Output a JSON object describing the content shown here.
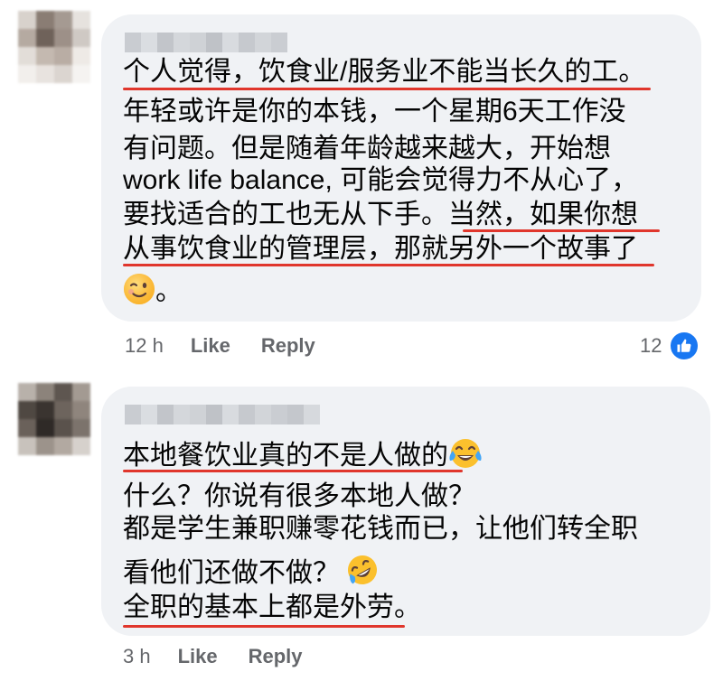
{
  "comments": [
    {
      "lines": [
        "个人觉得，饮食业/服务业不能当长久的工。",
        "年轻或许是你的本钱，一个星期6天工作没",
        "有问题。但是随着年龄越来越大，开始想",
        "work life balance, 可能会觉得力不从心了，",
        "要找适合的工也无从下手。当然，如果你想",
        "从事饮食业的管理层，那就另外一个故事了",
        "。"
      ],
      "emoji": "winking-face",
      "time": "12 h",
      "like_label": "Like",
      "reply_label": "Reply",
      "reaction_count": "12",
      "reaction_type": "like-icon"
    },
    {
      "lines": [
        "本地餐饮业真的不是人做的",
        "什么？你说有很多本地人做？",
        "都是学生兼职赚零花钱而已，让他们转全职",
        "看他们还做不做？",
        "全职的基本上都是外劳。"
      ],
      "emojis": [
        "face-with-tears-of-joy",
        "rolling-on-floor-laughing"
      ],
      "time": "3 h",
      "like_label": "Like",
      "reply_label": "Reply"
    }
  ],
  "colors": {
    "bubble": "#f0f2f5",
    "underline": "#e0362c",
    "meta_text": "#65676b",
    "like_blue": "#1877f2"
  }
}
